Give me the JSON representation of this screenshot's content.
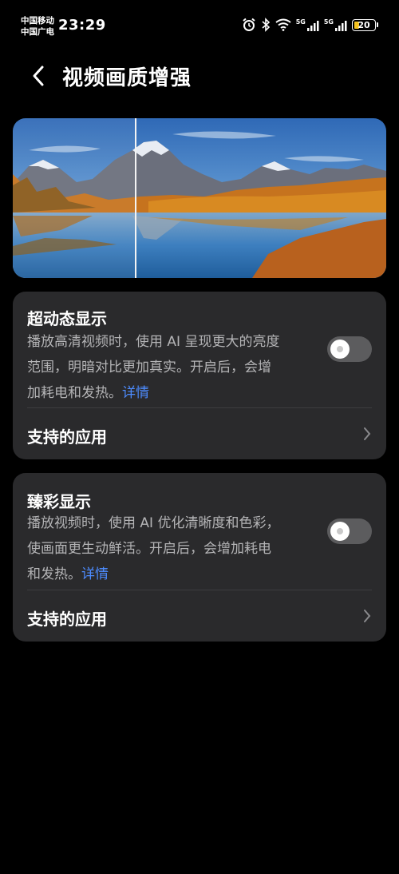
{
  "status_bar": {
    "carrier1": "中国移动",
    "carrier2": "中国广电",
    "time": "23:29",
    "signal1_label": "5G",
    "signal2_label": "5G",
    "battery": "20",
    "icons": [
      "alarm-icon",
      "bluetooth-icon",
      "wifi-icon",
      "signal-icon",
      "signal-icon",
      "battery-icon"
    ]
  },
  "header": {
    "title": "视频画质增强",
    "back_icon": "back-arrow-icon"
  },
  "cards": [
    {
      "title": "超动态显示",
      "desc_line1": "播放高清视频时，使用 AI 呈现更大的亮度",
      "desc_line2": "范围，明暗对比更加真实。开启后，会增",
      "desc_line3": "加耗电和发热。",
      "link": "详情",
      "toggle_on": false,
      "row_label": "支持的应用"
    },
    {
      "title": "臻彩显示",
      "desc_line1": "播放视频时，使用 AI 优化清晰度和色彩，",
      "desc_line2": "使画面更生动鲜活。开启后，会增加耗电",
      "desc_line3": "和发热。",
      "link": "详情",
      "toggle_on": false,
      "row_label": "支持的应用"
    }
  ],
  "colors": {
    "background": "#000000",
    "card": "#2a2a2c",
    "link": "#4d8cff",
    "toggle_off": "#5c5c5e",
    "battery_fill": "#f4c21f"
  }
}
